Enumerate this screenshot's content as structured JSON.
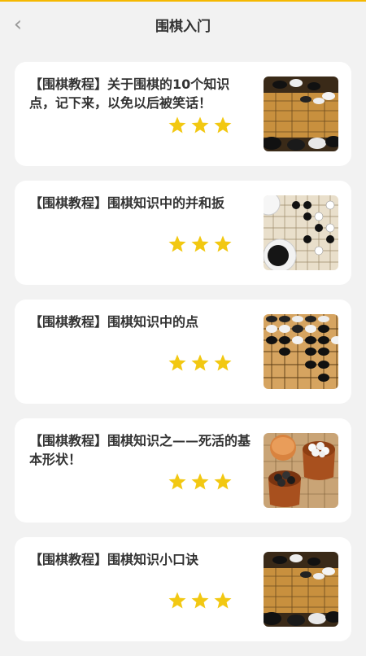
{
  "header": {
    "title": "围棋入门",
    "back_icon": "chevron-left-icon"
  },
  "accent_color": "#f5b800",
  "star_color": "#f2c812",
  "articles": [
    {
      "title": "【围棋教程】关于围棋的10个知识点，记下来，以免以后被笑话！",
      "rating": 3,
      "thumb": "go-stones-board-image"
    },
    {
      "title": "【围棋教程】围棋知识中的并和扳",
      "rating": 3,
      "thumb": "go-bowls-board-image"
    },
    {
      "title": "【围棋教程】围棋知识中的点",
      "rating": 3,
      "thumb": "go-board-closeup-image"
    },
    {
      "title": "【围棋教程】围棋知识之——死活的基本形状！",
      "rating": 3,
      "thumb": "go-stone-bowls-image"
    },
    {
      "title": "【围棋教程】围棋知识小口诀",
      "rating": 3,
      "thumb": "go-stones-board-image"
    }
  ]
}
